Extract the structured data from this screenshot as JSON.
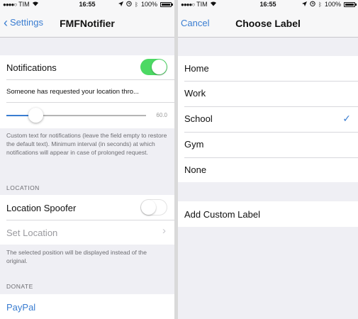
{
  "left": {
    "status": {
      "carrier": "TIM",
      "time": "16:55",
      "battery": "100%"
    },
    "nav": {
      "back_label": "Settings",
      "title": "FMFNotifier"
    },
    "notifications": {
      "label": "Notifications",
      "enabled": true,
      "text_value": "Someone has requested your location thro...",
      "slider_value": "60.0",
      "footnote": "Custom text for notifications (leave the field empty to restore the default text). Minimum interval (in seconds) at which notifications will appear in case of prolonged request."
    },
    "location": {
      "header": "LOCATION",
      "spoofer_label": "Location Spoofer",
      "spoofer_enabled": false,
      "set_location_label": "Set Location",
      "footnote": "The selected position will be displayed instead of the original."
    },
    "donate": {
      "header": "DONATE",
      "paypal_label": "PayPal"
    }
  },
  "right": {
    "status": {
      "carrier": "TIM",
      "time": "16:55",
      "battery": "100%"
    },
    "nav": {
      "cancel_label": "Cancel",
      "title": "Choose Label"
    },
    "labels": [
      "Home",
      "Work",
      "School",
      "Gym",
      "None"
    ],
    "selected_label": "School",
    "add_custom_label": "Add Custom Label"
  },
  "colors": {
    "accent": "#3a7dd1",
    "toggle_on": "#4cd964",
    "background": "#efeff4"
  }
}
